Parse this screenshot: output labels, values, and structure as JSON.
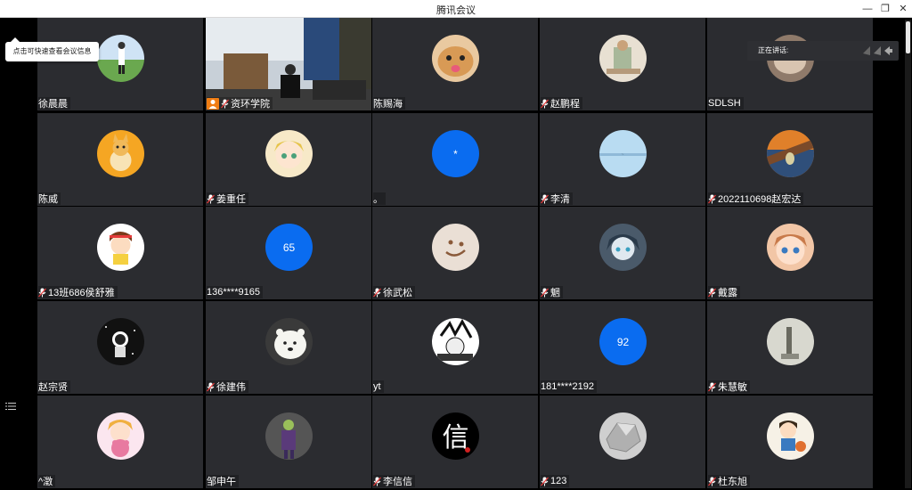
{
  "window": {
    "title": "腾讯会议"
  },
  "tooltip": {
    "text": "点击可快速查看会议信息"
  },
  "speaking": {
    "label": "正在讲话:"
  },
  "colors": {
    "tile_bg": "#2b2c30",
    "number_avatar": "#0a6cf0",
    "host_badge": "#f07d12"
  },
  "participants": [
    {
      "name": "徐晨晨",
      "mic": false,
      "avatar": "photo-person-field"
    },
    {
      "name": "资环学院",
      "mic": true,
      "host": true,
      "video": true
    },
    {
      "name": "陈赐海",
      "mic": false,
      "avatar": "photo-cat"
    },
    {
      "name": "赵鹏程",
      "mic": true,
      "avatar": "photo-person-sitting"
    },
    {
      "name": "SDLSH",
      "mic": false,
      "avatar": "photo-cat-hand"
    },
    {
      "name": "陈威",
      "mic": false,
      "avatar": "corgi-cartoon"
    },
    {
      "name": "姜重任",
      "mic": true,
      "avatar": "anime-girl"
    },
    {
      "name": "。",
      "mic": false,
      "avatar_text": "*",
      "avatar": "number"
    },
    {
      "name": "李清",
      "mic": true,
      "avatar": "sky-photo"
    },
    {
      "name": "2022110698赵宏达",
      "mic": true,
      "avatar": "scream-painting"
    },
    {
      "name": "13班686侯舒雅",
      "mic": true,
      "avatar": "cartoon-girl"
    },
    {
      "name": "136****9165",
      "mic": false,
      "avatar_text": "65",
      "avatar": "number"
    },
    {
      "name": "徐武松",
      "mic": true,
      "avatar": "smiley-face"
    },
    {
      "name": "魍",
      "mic": true,
      "avatar": "anime-character"
    },
    {
      "name": "戴露",
      "mic": true,
      "avatar": "anime-face"
    },
    {
      "name": "赵宗贤",
      "mic": false,
      "avatar": "space-sketch"
    },
    {
      "name": "徐建伟",
      "mic": true,
      "avatar": "polar-bear"
    },
    {
      "name": "yt",
      "mic": false,
      "avatar": "manga-sketch"
    },
    {
      "name": "181****2192",
      "mic": false,
      "avatar_text": "92",
      "avatar": "number"
    },
    {
      "name": "朱慧敏",
      "mic": true,
      "avatar": "photo-statue"
    },
    {
      "name": "^澂",
      "mic": false,
      "avatar": "anime-bear-girl"
    },
    {
      "name": "邹申午",
      "mic": false,
      "avatar": "joker-figure"
    },
    {
      "name": "李信信",
      "mic": true,
      "avatar": "calligraphy-xin"
    },
    {
      "name": "123",
      "mic": true,
      "avatar": "stone-blocks"
    },
    {
      "name": "杜东旭",
      "mic": true,
      "avatar": "cartoon-boy"
    }
  ]
}
